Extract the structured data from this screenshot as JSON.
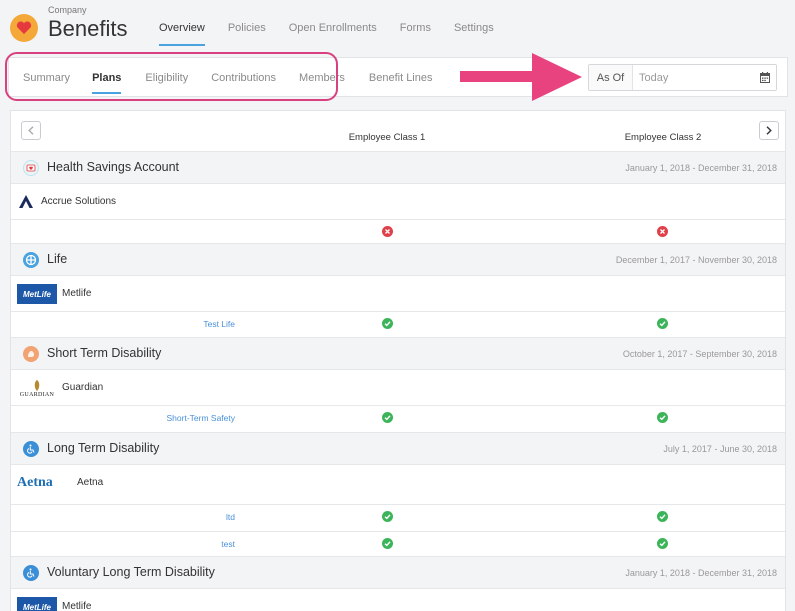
{
  "header": {
    "company_label": "Company",
    "title": "Benefits",
    "logo_icon": "heart-icon",
    "nav": [
      {
        "label": "Overview",
        "active": true
      },
      {
        "label": "Policies",
        "active": false
      },
      {
        "label": "Open Enrollments",
        "active": false
      },
      {
        "label": "Forms",
        "active": false
      },
      {
        "label": "Settings",
        "active": false
      }
    ]
  },
  "subnav": {
    "tabs": [
      {
        "label": "Summary",
        "active": false
      },
      {
        "label": "Plans",
        "active": true
      },
      {
        "label": "Eligibility",
        "active": false
      },
      {
        "label": "Contributions",
        "active": false
      },
      {
        "label": "Members",
        "active": false
      },
      {
        "label": "Benefit Lines",
        "active": false
      }
    ]
  },
  "as_of": {
    "label": "As Of",
    "placeholder": "Today"
  },
  "table": {
    "columns": [
      "Employee Class 1",
      "Employee Class 2"
    ],
    "sections": [
      {
        "title": "Health Savings Account",
        "dates": "January 1, 2018 - December 31, 2018",
        "icon": "hsa-icon",
        "icon_color": "#e9f5f7",
        "carrier": "Accrue Solutions",
        "carrier_logo": "accrue-logo",
        "plans": [
          {
            "name": "",
            "class1": "not-eligible",
            "class2": "not-eligible"
          }
        ]
      },
      {
        "title": "Life",
        "dates": "December 1, 2017 - November 30, 2018",
        "icon": "life-icon",
        "icon_color": "#4aa3df",
        "carrier": "Metlife",
        "carrier_logo": "metlife-logo",
        "plans": [
          {
            "name": "Test Life",
            "class1": "eligible",
            "class2": "eligible"
          }
        ]
      },
      {
        "title": "Short Term Disability",
        "dates": "October 1, 2017 - September 30, 2018",
        "icon": "std-icon",
        "icon_color": "#f2a373",
        "carrier": "Guardian",
        "carrier_logo": "guardian-logo",
        "plans": [
          {
            "name": "Short-Term Safety",
            "class1": "eligible",
            "class2": "eligible"
          }
        ]
      },
      {
        "title": "Long Term Disability",
        "dates": "July 1, 2017 - June 30, 2018",
        "icon": "wheelchair-icon",
        "icon_color": "#3b8fd6",
        "carrier": "Aetna",
        "carrier_logo": "aetna-logo",
        "plans": [
          {
            "name": "ltd",
            "class1": "eligible",
            "class2": "eligible"
          },
          {
            "name": "test",
            "class1": "eligible",
            "class2": "eligible"
          }
        ]
      },
      {
        "title": "Voluntary Long Term Disability",
        "dates": "January 1, 2018 - December 31, 2018",
        "icon": "wheelchair-icon",
        "icon_color": "#3b8fd6",
        "carrier": "Metlife",
        "carrier_logo": "metlife-logo",
        "plans": []
      }
    ]
  },
  "colors": {
    "accent": "#4aa3df",
    "highlight": "#d8417f",
    "eligible": "#3cb55a",
    "not_eligible": "#e0404a"
  },
  "logos": {
    "metlife": "MetLife",
    "guardian": "GUARDIAN",
    "aetna": "Aetna"
  }
}
